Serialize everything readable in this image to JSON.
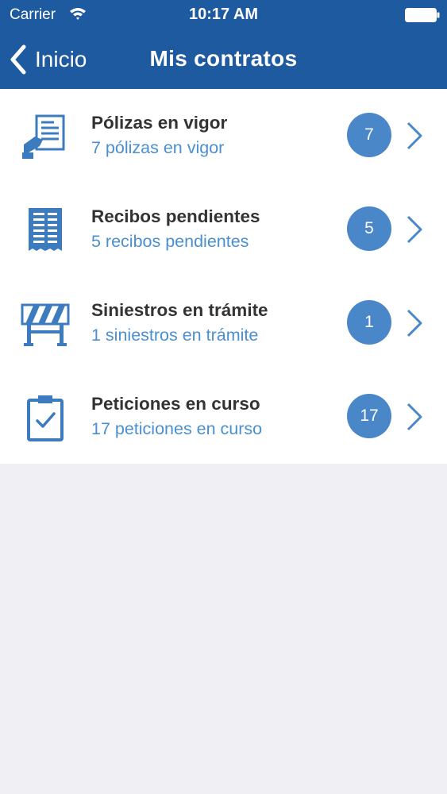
{
  "status_bar": {
    "carrier": "Carrier",
    "time": "10:17 AM"
  },
  "nav": {
    "back_label": "Inicio",
    "title": "Mis contratos"
  },
  "colors": {
    "header_bg": "#1e5aa0",
    "accent_blue": "#4a87c8",
    "subtitle_blue": "#4a8fd0",
    "background_gray": "#efeff4"
  },
  "rows": [
    {
      "icon": "document-policy-icon",
      "title": "Pólizas en vigor",
      "subtitle": "7 pólizas en vigor",
      "count": "7"
    },
    {
      "icon": "receipt-icon",
      "title": "Recibos pendientes",
      "subtitle": "5 recibos pendientes",
      "count": "5"
    },
    {
      "icon": "barrier-icon",
      "title": "Siniestros en trámite",
      "subtitle": "1 siniestros en trámite",
      "count": "1"
    },
    {
      "icon": "clipboard-check-icon",
      "title": "Peticiones en curso",
      "subtitle": "17 peticiones en curso",
      "count": "17"
    }
  ]
}
